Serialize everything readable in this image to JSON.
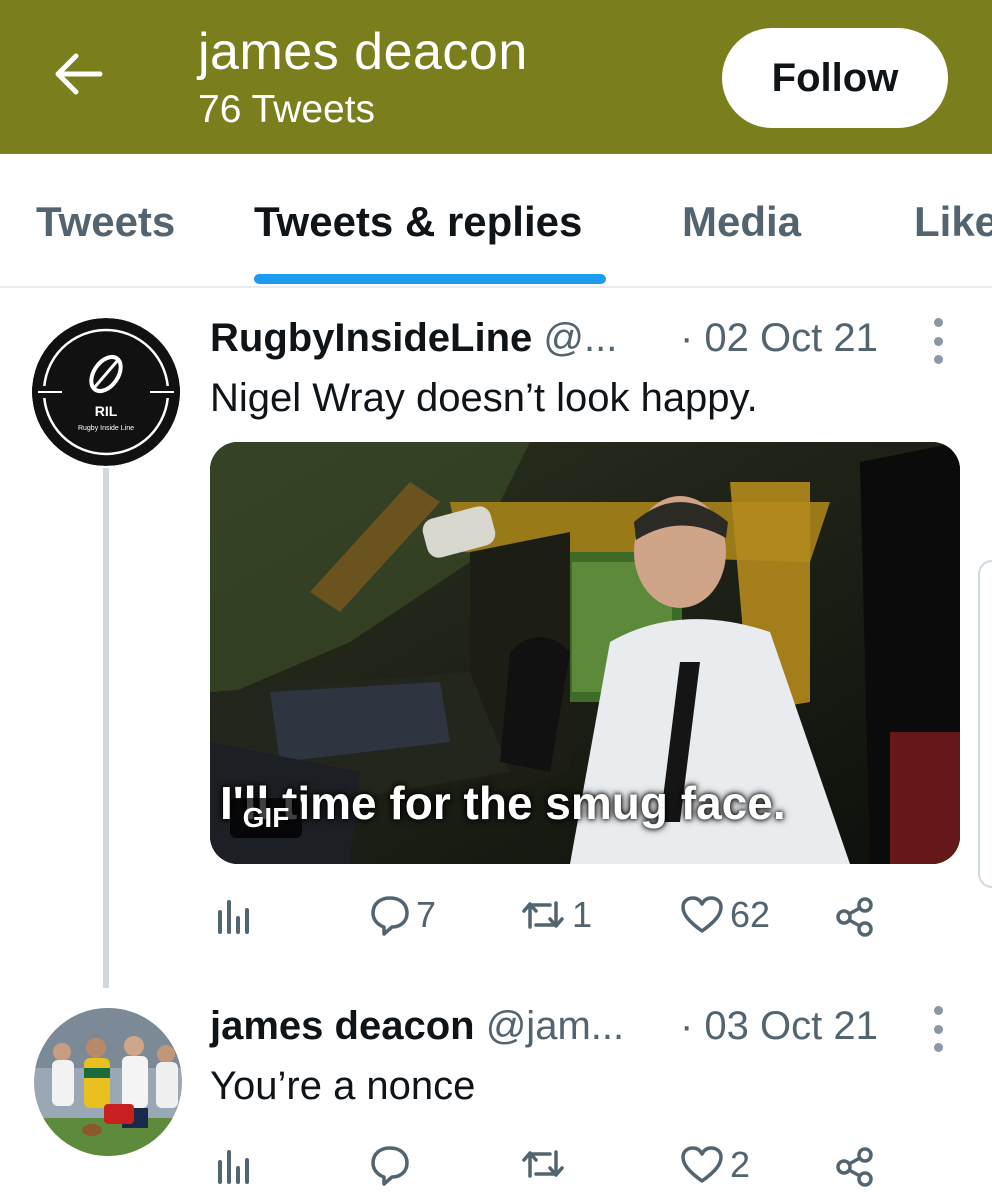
{
  "colors": {
    "header_bg": "#7a7e1c",
    "tab_indicator": "#1d9bf0",
    "muted_text": "#536471"
  },
  "header": {
    "back_icon": "arrow-left-icon",
    "name": "james deacon",
    "tweet_count": "76 Tweets",
    "follow_label": "Follow"
  },
  "tabs": [
    {
      "label": "Tweets",
      "active": false
    },
    {
      "label": "Tweets & replies",
      "active": true
    },
    {
      "label": "Media",
      "active": false
    },
    {
      "label": "Like",
      "active": false
    }
  ],
  "tweets": [
    {
      "name": "RugbyInsideLine",
      "handle": "@...",
      "date": "· 02 Oct 21",
      "text": "Nigel Wray doesn’t look happy.",
      "avatar": {
        "title": "RIL",
        "subtitle": "Rugby Inside Line"
      },
      "media": {
        "caption": "I'll time for the smug face.",
        "badge": "GIF"
      },
      "actions": {
        "analytics": "",
        "replies": "7",
        "retweets": "1",
        "likes": "62",
        "share": ""
      }
    },
    {
      "name": "james deacon",
      "handle": "@jam...",
      "date": "· 03 Oct 21",
      "text": "You’re a nonce",
      "actions": {
        "analytics": "",
        "replies": "",
        "retweets": "",
        "likes": "2",
        "share": ""
      }
    }
  ]
}
